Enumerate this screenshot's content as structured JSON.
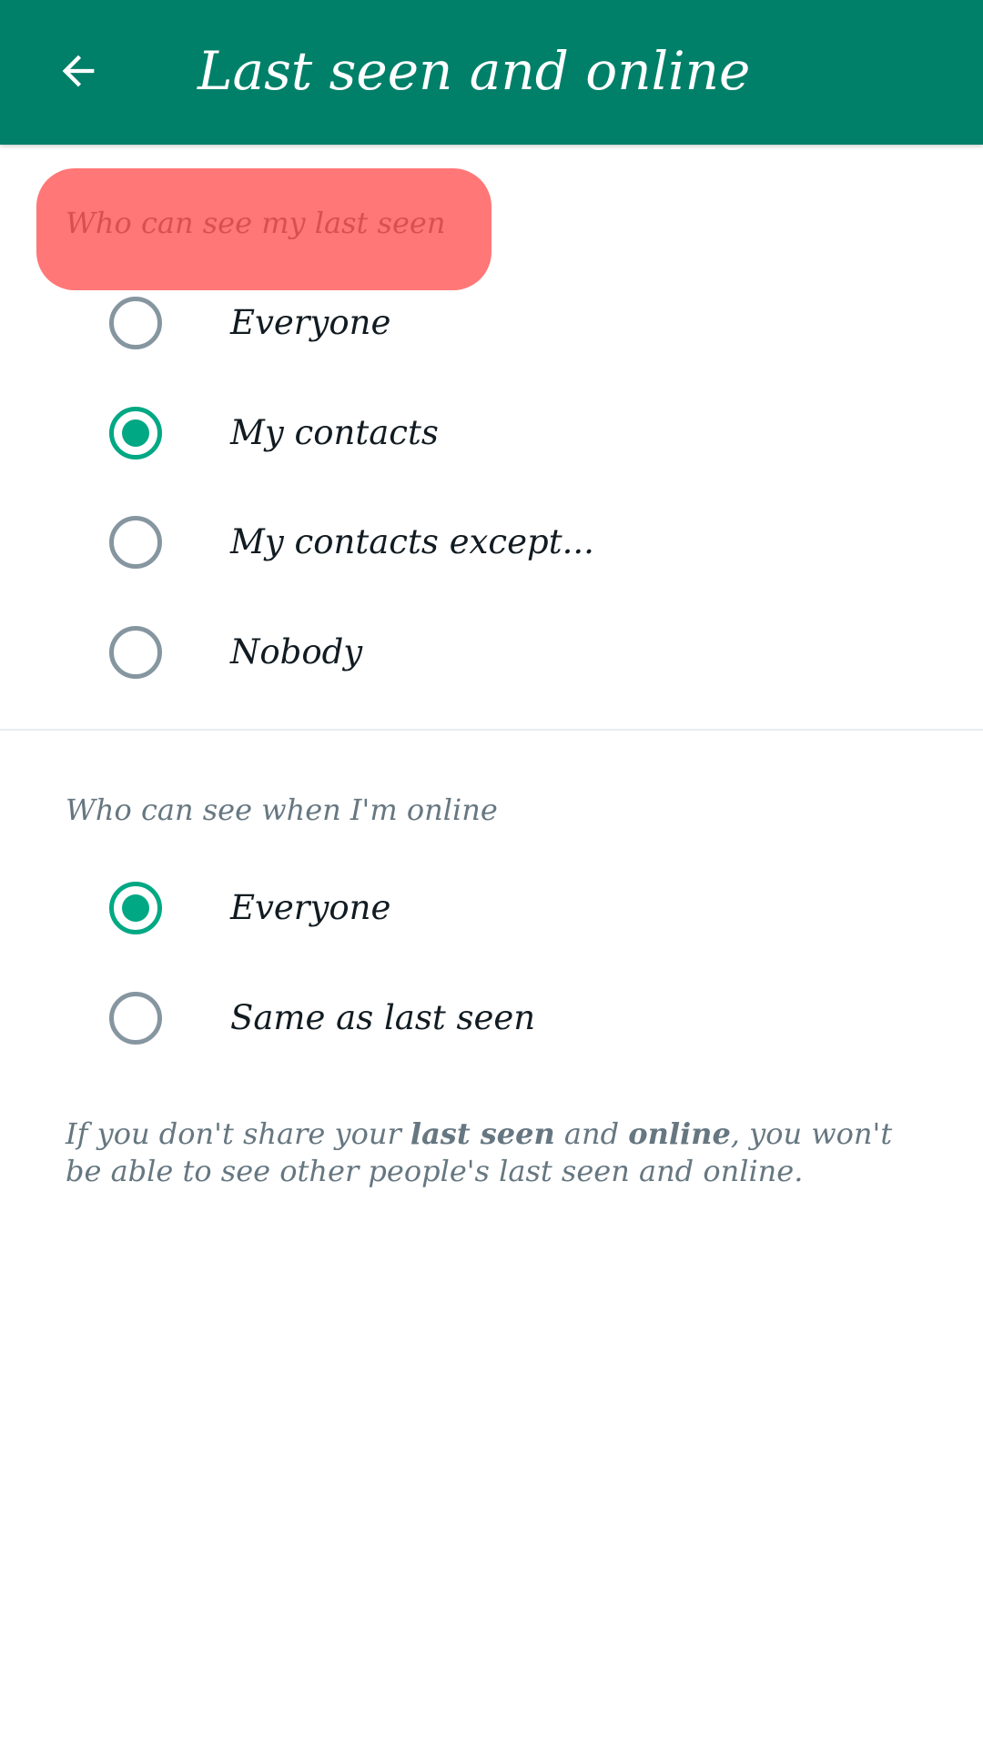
{
  "appbar": {
    "title": "Last seen and online",
    "back_icon": "arrow-left-icon",
    "background_color": "#008069"
  },
  "last_seen": {
    "header": "Who can see my last seen",
    "options": [
      {
        "label": "Everyone",
        "selected": false
      },
      {
        "label": "My contacts",
        "selected": true
      },
      {
        "label": "My contacts except...",
        "selected": false
      },
      {
        "label": "Nobody",
        "selected": false
      }
    ]
  },
  "online": {
    "header": "Who can see when I'm online",
    "options": [
      {
        "label": "Everyone",
        "selected": true
      },
      {
        "label": "Same as last seen",
        "selected": false
      }
    ]
  },
  "footer": {
    "part1": "If you don't share your ",
    "bold1": "last seen",
    "part2": " and ",
    "bold2": "online",
    "part3": ", you won't be able to see other people's last seen and online."
  },
  "colors": {
    "accent": "#00a884",
    "highlight": "#ff7777"
  }
}
